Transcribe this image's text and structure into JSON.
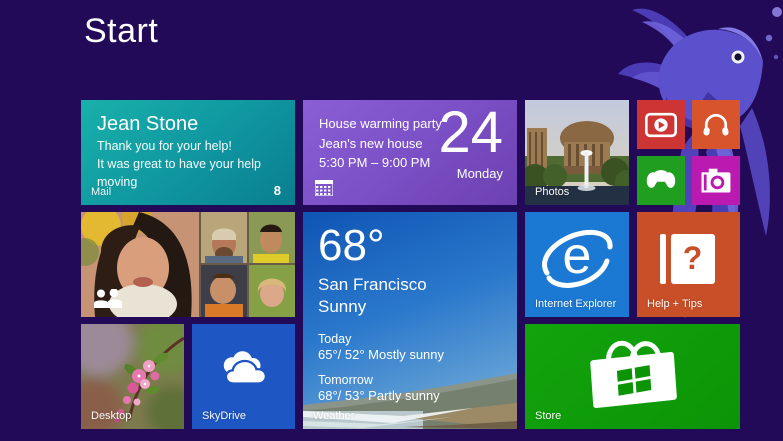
{
  "screen": {
    "title": "Start"
  },
  "colors": {
    "background": "#230a59",
    "mail_teal": "#0f96a0",
    "calendar_purple": "#7a4ec4",
    "weather_blue": "#2a78cc",
    "ie_blue": "#1b79d4",
    "skydrive_blue": "#1e56c4",
    "help_orange": "#c84f28",
    "store_green": "#0c9406",
    "video_red": "#cd3535",
    "music_orange": "#d8542c",
    "games_green": "#1f9e1f",
    "camera_magenta": "#bb1ab0"
  },
  "tiles": {
    "mail": {
      "sender": "Jean Stone",
      "line1": "Thank you for your help!",
      "line2": "It was great to have your help moving",
      "label": "Mail",
      "badge": "8"
    },
    "calendar": {
      "event": "House warming party",
      "location": "Jean's new house",
      "time": "5:30 PM – 9:00 PM",
      "day": "24",
      "weekday": "Monday"
    },
    "photos": {
      "label": "Photos"
    },
    "weather": {
      "temp": "68°",
      "city": "San Francisco",
      "condition": "Sunny",
      "today_label": "Today",
      "today_forecast": "65°/ 52° Mostly sunny",
      "tomorrow_label": "Tomorrow",
      "tomorrow_forecast": "68°/ 53° Partly sunny",
      "label": "Weather"
    },
    "internet_explorer": {
      "label": "Internet Explorer"
    },
    "help": {
      "label": "Help + Tips",
      "glyph": "?"
    },
    "desktop": {
      "label": "Desktop"
    },
    "skydrive": {
      "label": "SkyDrive"
    },
    "store": {
      "label": "Store"
    }
  },
  "icons": {
    "calendar_grid": "calendar-grid-icon",
    "people": "people-icon",
    "video": "video-player-icon",
    "music": "headphones-icon",
    "games": "xbox-controller-icon",
    "camera": "camera-icon",
    "ie_logo": "internet-explorer-e-icon",
    "help_book": "book-question-icon",
    "cloud": "skydrive-cloud-icon",
    "store_bag": "shopping-bag-windows-icon",
    "fish": "betta-fish-graphic"
  }
}
